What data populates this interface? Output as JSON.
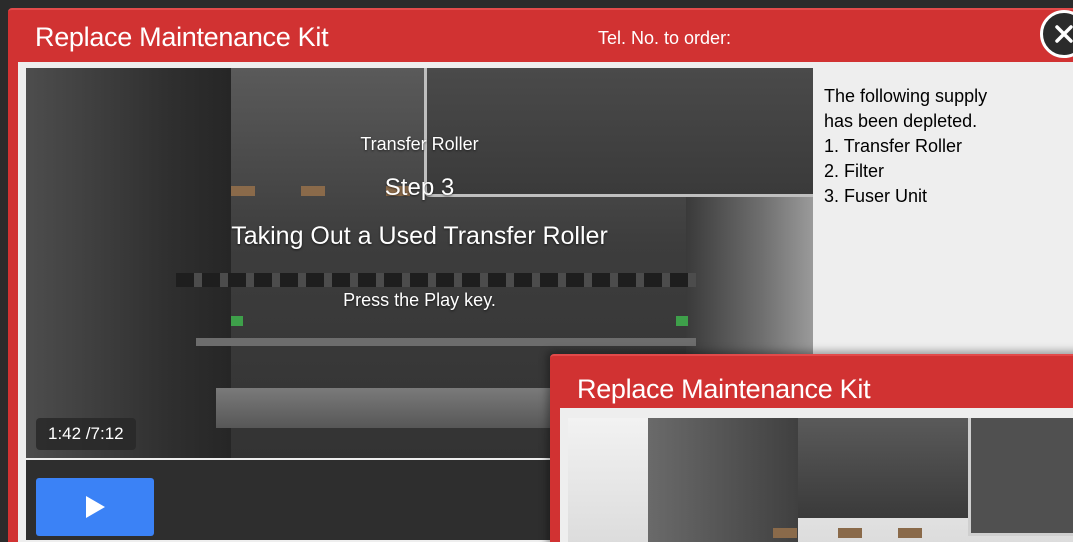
{
  "dialog": {
    "title": "Replace Maintenance Kit",
    "tel_label": "Tel. No. to order:",
    "close_icon": "close-icon"
  },
  "video": {
    "subtitle": "Transfer Roller",
    "step": "Step 3",
    "heading": "Taking Out a Used Transfer Roller",
    "hint": "Press the Play key.",
    "time": "1:42  /7:12",
    "play_icon": "play-icon"
  },
  "info": {
    "line1": "The following supply",
    "line2": "has been depleted.",
    "items": [
      "1. Transfer Roller",
      "2. Filter",
      "3. Fuser Unit"
    ]
  },
  "dialog2": {
    "title": "Replace Maintenance Kit"
  },
  "colors": {
    "title_bar": "#d13232",
    "content_bg": "#eeeeee",
    "play_button": "#3b82f6",
    "controls_bg": "#2e2e2e"
  }
}
